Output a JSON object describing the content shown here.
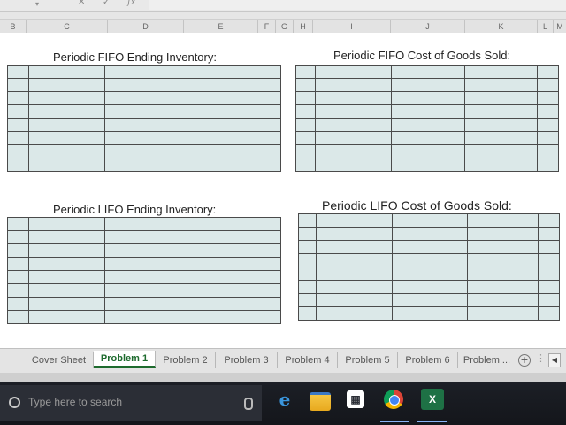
{
  "formula_bar": {
    "cancel_glyph": "✕",
    "enter_glyph": "✓",
    "fx_label": "fx"
  },
  "column_headers": [
    "B",
    "C",
    "D",
    "E",
    "F",
    "G",
    "H",
    "I",
    "J",
    "K",
    "L",
    "M"
  ],
  "blocks": {
    "fifo_ending": {
      "title": "Periodic FIFO Ending Inventory:"
    },
    "fifo_cogs": {
      "title": "Periodic FIFO Cost of Goods Sold:"
    },
    "lifo_ending": {
      "title": "Periodic LIFO Ending Inventory:"
    },
    "lifo_cogs": {
      "title": "Periodic LIFO Cost of Goods Sold:"
    }
  },
  "sheet_tabs": [
    {
      "label": "Cover Sheet",
      "active": false
    },
    {
      "label": "Problem 1",
      "active": true
    },
    {
      "label": "Problem 2",
      "active": false
    },
    {
      "label": "Problem 3",
      "active": false
    },
    {
      "label": "Problem 4",
      "active": false
    },
    {
      "label": "Problem 5",
      "active": false
    },
    {
      "label": "Problem 6",
      "active": false
    },
    {
      "label": "Problem ...",
      "active": false
    }
  ],
  "tab_controls": {
    "add": "+",
    "more": "⋮",
    "scroll": "◀"
  },
  "taskbar": {
    "search_placeholder": "Type here to search",
    "icons": [
      "microphone-icon",
      "edge-icon",
      "file-explorer-icon",
      "store-icon",
      "chrome-icon",
      "excel-icon"
    ],
    "excel_label": "X"
  },
  "colors": {
    "grid_fill": "#dbe8e8",
    "active_tab": "#1e6b2e",
    "taskbar": "#14161b"
  }
}
